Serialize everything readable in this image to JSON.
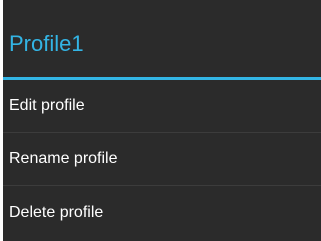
{
  "dialog": {
    "title": "Profile1",
    "items": [
      {
        "label": "Edit profile"
      },
      {
        "label": "Rename profile"
      },
      {
        "label": "Delete profile"
      }
    ]
  },
  "colors": {
    "accent": "#33b5e5",
    "background": "#2b2b2b",
    "text": "#ffffff"
  }
}
